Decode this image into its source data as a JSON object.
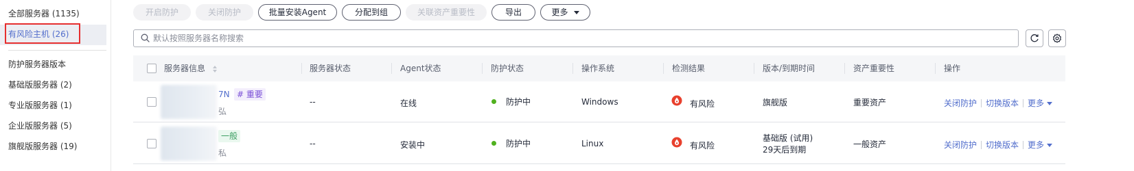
{
  "sidebar": {
    "all_servers": "全部服务器 (1135)",
    "risky_hosts": "有风险主机 (26)",
    "edition_heading": "防护服务器版本",
    "basic": "基础版服务器 (2)",
    "professional": "专业版服务器 (1)",
    "enterprise": "企业版服务器 (5)",
    "flagship": "旗舰版服务器 (19)"
  },
  "toolbar": {
    "enable_protection": "开启防护",
    "disable_protection": "关闭防护",
    "batch_install_agent": "批量安装Agent",
    "assign_group": "分配到组",
    "link_asset_importance": "关联资产重要性",
    "export": "导出",
    "more": "更多"
  },
  "search": {
    "placeholder": "默认按照服务器名称搜索",
    "value": ""
  },
  "table": {
    "headers": {
      "server_info": "服务器信息",
      "server_status": "服务器状态",
      "agent_status": "Agent状态",
      "protection_status": "防护状态",
      "os": "操作系统",
      "detection_result": "检测结果",
      "edition_expiry": "版本/到期时间",
      "asset_importance": "资产重要性",
      "actions": "操作"
    },
    "rows": [
      {
        "name_fragment": "7N",
        "tag": "# 重要",
        "ip_fragment": "弘",
        "server_status": "--",
        "agent_status": "在线",
        "protection_status": "防护中",
        "os": "Windows",
        "detection_result": "有风险",
        "edition": "旗舰版",
        "expiry": "",
        "asset_importance": "重要资产",
        "action_disable": "关闭防护",
        "action_switch": "切换版本",
        "action_more": "更多"
      },
      {
        "name_fragment": "",
        "tag": "一般",
        "ip_fragment": "私",
        "server_status": "--",
        "agent_status": "安装中",
        "protection_status": "防护中",
        "os": "Linux",
        "detection_result": "有风险",
        "edition": "基础版 (试用)",
        "expiry": "29天后到期",
        "asset_importance": "一般资产",
        "action_disable": "关闭防护",
        "action_switch": "切换版本",
        "action_more": "更多"
      }
    ]
  },
  "colors": {
    "accent": "#526ecc",
    "risk": "#e8402d",
    "online_dot": "#50b11f",
    "highlight_box": "#e62e2e"
  },
  "icons": {
    "search": "search-icon",
    "refresh": "refresh-icon",
    "settings": "gear-icon",
    "sort": "sort-icon",
    "risk": "risk-drop-icon"
  }
}
